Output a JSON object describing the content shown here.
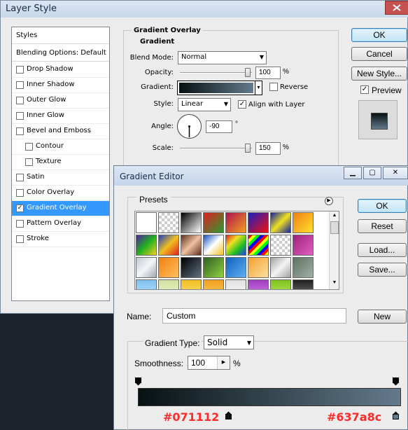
{
  "layer_style": {
    "title": "Layer Style",
    "styles_header": "Styles",
    "blending_options": "Blending Options: Default",
    "items": [
      {
        "label": "Drop Shadow",
        "checked": false,
        "indent": false,
        "selected": false
      },
      {
        "label": "Inner Shadow",
        "checked": false,
        "indent": false,
        "selected": false
      },
      {
        "label": "Outer Glow",
        "checked": false,
        "indent": false,
        "selected": false
      },
      {
        "label": "Inner Glow",
        "checked": false,
        "indent": false,
        "selected": false
      },
      {
        "label": "Bevel and Emboss",
        "checked": false,
        "indent": false,
        "selected": false
      },
      {
        "label": "Contour",
        "checked": false,
        "indent": true,
        "selected": false
      },
      {
        "label": "Texture",
        "checked": false,
        "indent": true,
        "selected": false
      },
      {
        "label": "Satin",
        "checked": false,
        "indent": false,
        "selected": false
      },
      {
        "label": "Color Overlay",
        "checked": false,
        "indent": false,
        "selected": false
      },
      {
        "label": "Gradient Overlay",
        "checked": true,
        "indent": false,
        "selected": true
      },
      {
        "label": "Pattern Overlay",
        "checked": false,
        "indent": false,
        "selected": false
      },
      {
        "label": "Stroke",
        "checked": false,
        "indent": false,
        "selected": false
      }
    ],
    "gradient_overlay": {
      "title": "Gradient Overlay",
      "subtitle": "Gradient",
      "blend_mode_label": "Blend Mode:",
      "blend_mode_value": "Normal",
      "opacity_label": "Opacity:",
      "opacity_value": "100",
      "opacity_unit": "%",
      "gradient_label": "Gradient:",
      "reverse_label": "Reverse",
      "reverse_checked": false,
      "style_label": "Style:",
      "style_value": "Linear",
      "align_label": "Align with Layer",
      "align_checked": true,
      "angle_label": "Angle:",
      "angle_value": "-90",
      "angle_unit": "°",
      "scale_label": "Scale:",
      "scale_value": "150",
      "scale_unit": "%"
    },
    "buttons": {
      "ok": "OK",
      "cancel": "Cancel",
      "new_style": "New Style...",
      "preview_label": "Preview",
      "preview_checked": true
    }
  },
  "gradient_editor": {
    "title": "Gradient Editor",
    "presets_label": "Presets",
    "buttons": {
      "ok": "OK",
      "reset": "Reset",
      "load": "Load...",
      "save": "Save...",
      "new": "New"
    },
    "name_label": "Name:",
    "name_value": "Custom",
    "gradient_type_label": "Gradient Type:",
    "gradient_type_value": "Solid",
    "smoothness_label": "Smoothness:",
    "smoothness_value": "100",
    "smoothness_unit": "%",
    "stops": {
      "left_color": "#071112",
      "right_color": "#637a8c"
    },
    "stop_labels": {
      "left": "#071112",
      "right": "#637a8c"
    }
  },
  "colors": {
    "selection": "#3399ff",
    "label_red": "#ff2a2a"
  }
}
